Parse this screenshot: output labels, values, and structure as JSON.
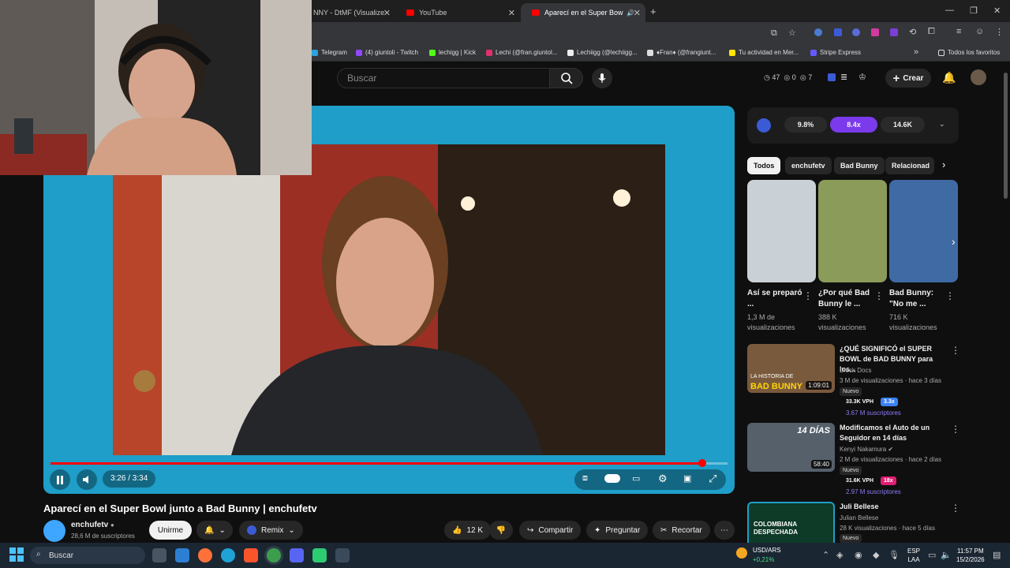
{
  "browser": {
    "tabs": [
      {
        "title": "NNY - DtMF (Visualize"
      },
      {
        "title": "YouTube"
      },
      {
        "title": "Aparecí en el Super Bowl ju"
      }
    ],
    "bookmarks": [
      "Telegram",
      "(4) giuntoli - Twitch",
      "lechigg | Kick",
      "Lechi (@fran.giuntol...",
      "Lechiigg (@lechiigg...",
      "♦Fran♦ (@frangiunt...",
      "Tu actividad en Mer...",
      "Stripe Express"
    ],
    "favorites_label": "Todos los favoritos"
  },
  "header": {
    "search_placeholder": "Buscar",
    "stats": {
      "a": "47",
      "b": "0",
      "c": "7"
    },
    "create_label": "Crear"
  },
  "player": {
    "time": "3:26 / 3:34",
    "progress_fraction": 0.963
  },
  "video": {
    "title": "Aparecí en el Super Bowl junto a Bad Bunny | enchufetv",
    "channel": "enchufetv",
    "subscribers": "28,6 M de suscriptores",
    "join_label": "Unirme",
    "remix_label": "Remix",
    "likes": "12 K",
    "share_label": "Compartir",
    "ask_label": "Preguntar",
    "clip_label": "Recortar"
  },
  "sidebar": {
    "iq": {
      "a": "9.8%",
      "b": "8.4x",
      "c": "14.6K"
    },
    "chips": [
      "Todos",
      "enchufetv",
      "Bad Bunny",
      "Relacionad"
    ],
    "shorts": [
      {
        "title": "Así se preparó ...",
        "views": "1,3 M de visualizaciones",
        "color": "#c9d1d6"
      },
      {
        "title": "¿Por qué Bad Bunny le ...",
        "views": "388 K visualizaciones",
        "color": "#8a9b5a"
      },
      {
        "title": "Bad Bunny: \"No me ...",
        "views": "716 K visualizaciones",
        "color": "#3f6aa3"
      }
    ],
    "recs": [
      {
        "title": "¿QUÉ SIGNIFICÓ el SUPER BOWL de BAD BUNNY para los...",
        "channel": "Dieck Docs",
        "meta": "3 M de visualizaciones · hace 3 días",
        "badge": "Nuevo",
        "vph": "33.3K VPH",
        "mult": "3.3x",
        "mult_color": "#3b82f6",
        "subs": "3.67 M suscriptores",
        "duration": "1:09:01",
        "thumb_text": "BAD BUNNY",
        "thumb_sub": "LA HISTORIA DE"
      },
      {
        "title": "Modificamos el Auto de un Seguidor en 14 días",
        "channel": "Kenyi Nakamura",
        "meta": "2 M de visualizaciones · hace 2 días",
        "badge": "Nuevo",
        "vph": "31.6K VPH",
        "mult": "18x",
        "mult_color": "#e11d74",
        "subs": "2.97 M suscriptores",
        "duration": "58:40",
        "thumb_text": "14 DÍAS",
        "thumb_sub": ""
      },
      {
        "title": "Juli Bellese",
        "channel": "Julian Bellese",
        "meta": "28 K visualizaciones · hace 5 días",
        "badge": "Nuevo",
        "vph": "",
        "mult": "",
        "mult_color": "",
        "subs": "",
        "duration": "",
        "thumb_text": "COLOMBIANA DESPECHADA",
        "thumb_sub": ""
      }
    ]
  },
  "taskbar": {
    "search": "Buscar",
    "ticker": "USD/ARS",
    "ticker_change": "+0,21%",
    "lang": "ESP",
    "lang2": "LAA",
    "time": "11:57 PM",
    "date": "15/2/2026"
  }
}
